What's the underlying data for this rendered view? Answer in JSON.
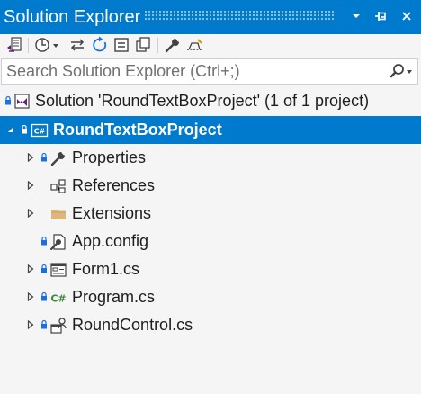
{
  "panel": {
    "title": "Solution Explorer",
    "accent_color": "#007acc"
  },
  "title_buttons": [
    {
      "icon": "dropdown-arrow-icon"
    },
    {
      "icon": "pin-icon"
    },
    {
      "icon": "close-icon"
    }
  ],
  "toolbar": {
    "items": [
      {
        "icon": "switch-views-icon"
      },
      {
        "icon": "pending-changes-filter-icon"
      },
      {
        "icon": "sync-with-active-document-icon"
      },
      {
        "icon": "refresh-icon"
      },
      {
        "icon": "collapse-all-icon"
      },
      {
        "icon": "show-all-files-icon"
      },
      {
        "icon": "properties-wrench-icon"
      },
      {
        "icon": "preview-selected-items-icon"
      }
    ]
  },
  "search": {
    "placeholder": "Search Solution Explorer (Ctrl+;)",
    "value": ""
  },
  "tree": {
    "solution": {
      "label": "Solution 'RoundTextBoxProject' (1 of 1 project)",
      "icon": "visual-studio-solution-icon"
    },
    "project": {
      "label": "RoundTextBoxProject",
      "icon": "csharp-project-icon",
      "expanded": true,
      "selected": true
    },
    "items": [
      {
        "label": "Properties",
        "icon": "wrench-icon",
        "expandable": true,
        "locked": true
      },
      {
        "label": "References",
        "icon": "references-icon",
        "expandable": true,
        "locked": false
      },
      {
        "label": "Extensions",
        "icon": "folder-icon",
        "expandable": true,
        "locked": false
      },
      {
        "label": "App.config",
        "icon": "config-file-icon",
        "expandable": false,
        "locked": true
      },
      {
        "label": "Form1.cs",
        "icon": "form-icon",
        "expandable": true,
        "locked": true
      },
      {
        "label": "Program.cs",
        "icon": "csharp-file-icon",
        "expandable": true,
        "locked": true
      },
      {
        "label": "RoundControl.cs",
        "icon": "user-control-icon",
        "expandable": true,
        "locked": true
      }
    ]
  }
}
